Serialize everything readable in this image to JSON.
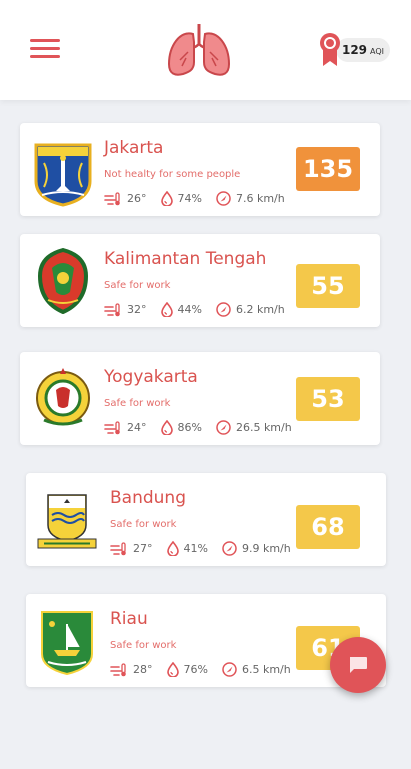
{
  "header": {
    "aqi_value": "129",
    "aqi_unit": "AQI",
    "colors": {
      "accent": "#e05458",
      "lungs": "#f08a8c"
    }
  },
  "cities": [
    {
      "name": "Jakarta",
      "status": "Not healty for some people",
      "temp": "26°",
      "humidity": "74%",
      "wind": "7.6 km/h",
      "aqi": "135",
      "aqi_color": "#f0923b"
    },
    {
      "name": "Kalimantan Tengah",
      "status": "Safe for work",
      "temp": "32°",
      "humidity": "44%",
      "wind": "6.2 km/h",
      "aqi": "55",
      "aqi_color": "#f4c84a"
    },
    {
      "name": "Yogyakarta",
      "status": "Safe for work",
      "temp": "24°",
      "humidity": "86%",
      "wind": "26.5 km/h",
      "aqi": "53",
      "aqi_color": "#f4c84a"
    },
    {
      "name": "Bandung",
      "status": "Safe for work",
      "temp": "27°",
      "humidity": "41%",
      "wind": "9.9 km/h",
      "aqi": "68",
      "aqi_color": "#f4c84a"
    },
    {
      "name": "Riau",
      "status": "Safe for work",
      "temp": "28°",
      "humidity": "76%",
      "wind": "6.5 km/h",
      "aqi": "61",
      "aqi_color": "#f4c84a"
    }
  ],
  "icons": {
    "menu": "menu-icon",
    "logo": "lungs-icon",
    "badge": "award-badge-icon",
    "temp": "wind-thermometer-icon",
    "humidity": "droplet-icon",
    "wind": "navigation-arrow-icon",
    "fab": "chat-icon"
  }
}
